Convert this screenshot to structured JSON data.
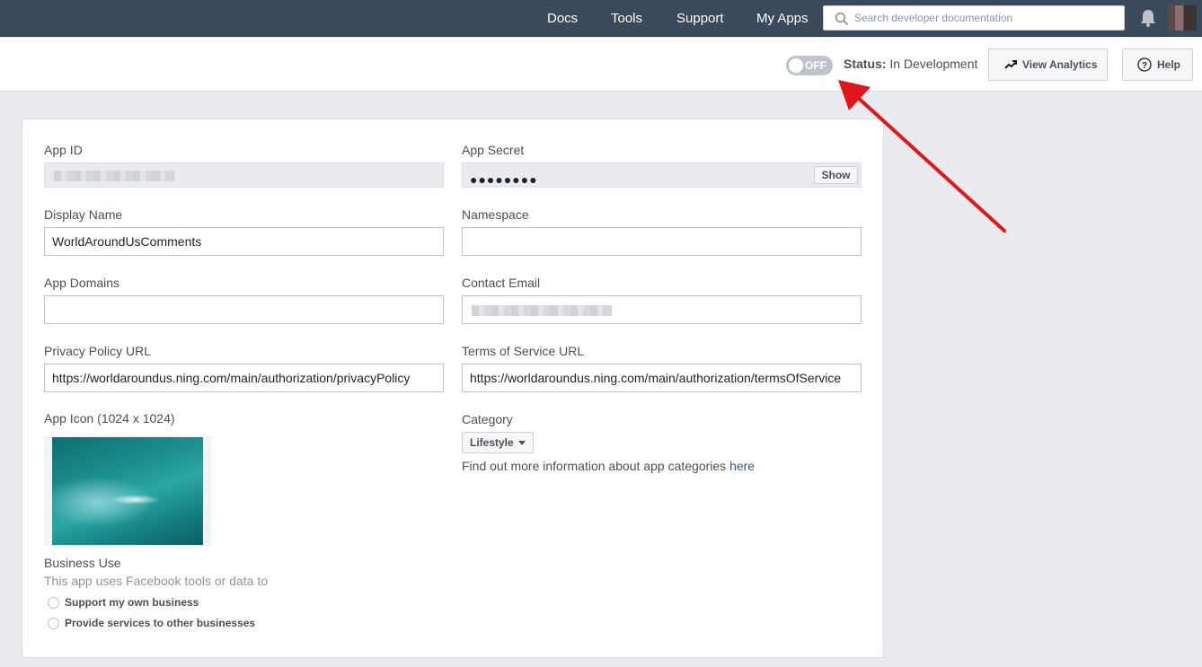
{
  "topnav": {
    "links": [
      "Docs",
      "Tools",
      "Support",
      "My Apps"
    ],
    "search_placeholder": "Search developer documentation"
  },
  "subheader": {
    "toggle_label": "OFF",
    "status_label": "Status:",
    "status_value": "In Development",
    "analytics_label": "View Analytics",
    "help_label": "Help"
  },
  "form": {
    "app_id_label": "App ID",
    "app_secret_label": "App Secret",
    "app_secret_value": "●●●●●●●●",
    "show_label": "Show",
    "display_name_label": "Display Name",
    "display_name_value": "WorldAroundUsComments",
    "namespace_label": "Namespace",
    "namespace_value": "",
    "app_domains_label": "App Domains",
    "app_domains_value": "",
    "contact_email_label": "Contact Email",
    "privacy_label": "Privacy Policy URL",
    "privacy_value": "https://worldaroundus.ning.com/main/authorization/privacyPolicy",
    "tos_label": "Terms of Service URL",
    "tos_value": "https://worldaroundus.ning.com/main/authorization/termsOfService",
    "app_icon_label": "App Icon (1024 x 1024)",
    "category_label": "Category",
    "category_value": "Lifestyle",
    "category_info": "Find out more information about app categories ",
    "category_link": "here",
    "business_use_label": "Business Use",
    "business_use_desc": "This app uses Facebook tools or data to",
    "business_options": [
      "Support my own business",
      "Provide services to other businesses"
    ]
  },
  "colors": {
    "nav_bg": "#3b4a5a",
    "toggle_off": "#bec3c9",
    "link": "#365899",
    "arrow": "#e0161b"
  }
}
